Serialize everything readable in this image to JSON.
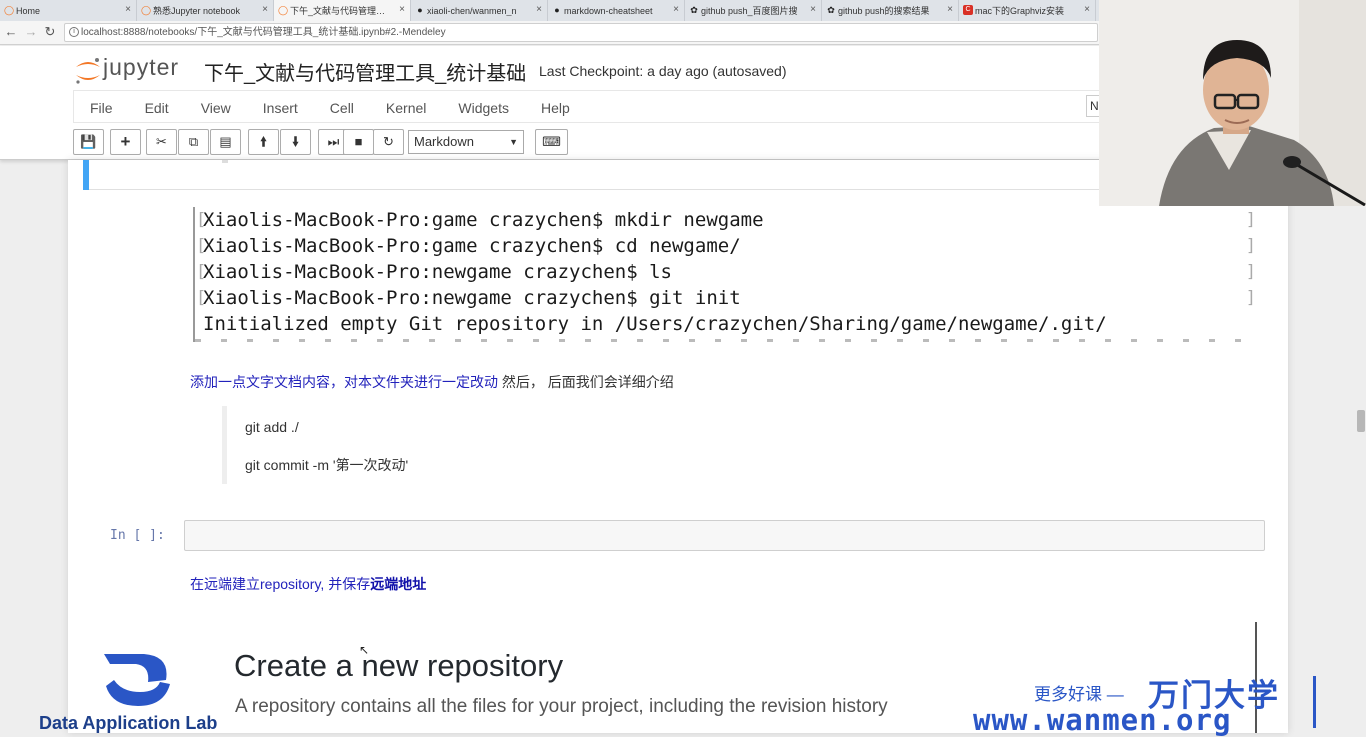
{
  "browser": {
    "tabs": [
      {
        "label": "Home",
        "icon": "jupyter-icon"
      },
      {
        "label": "熟悉Jupyter notebook",
        "icon": "jupyter-icon"
      },
      {
        "label": "下午_文献与代码管理工具",
        "icon": "jupyter-icon"
      },
      {
        "label": "xiaoli-chen/wanmen_n",
        "icon": "github-icon"
      },
      {
        "label": "markdown-cheatsheet",
        "icon": "github-icon"
      },
      {
        "label": "github push_百度图片搜",
        "icon": "baidu-icon"
      },
      {
        "label": "github push的搜索结果",
        "icon": "baidu-icon"
      },
      {
        "label": "mac下的Graphviz安装",
        "icon": "csdn-icon"
      }
    ],
    "active_tab_index": 2,
    "url": "localhost:8888/notebooks/下午_文献与代码管理工具_统计基础.ipynb#2.-Mendeley"
  },
  "jupyter": {
    "logo_text": "jupyter",
    "notebook_title": "下午_文献与代码管理工具_统计基础",
    "checkpoint": "Last Checkpoint: a day ago (autosaved)",
    "menu": [
      "File",
      "Edit",
      "View",
      "Insert",
      "Cell",
      "Kernel",
      "Widgets",
      "Help"
    ],
    "kernel_indicator": "N",
    "cell_type": "Markdown"
  },
  "terminal": {
    "lines": [
      "Xiaolis-MacBook-Pro:game crazychen$ mkdir newgame",
      "Xiaolis-MacBook-Pro:game crazychen$ cd newgame/",
      "Xiaolis-MacBook-Pro:newgame crazychen$ ls",
      "Xiaolis-MacBook-Pro:newgame crazychen$ git init",
      "Initialized empty Git repository in /Users/crazychen/Sharing/game/newgame/.git/"
    ]
  },
  "cells": {
    "md1_blue": "添加一点文字文档内容，对本文件夹进行一定改动",
    "md1_rest": " 然后， 后面我们会详细介绍",
    "quote_lines": [
      "git add ./",
      "git commit -m '第一次改动'"
    ],
    "code_prompt": "In [ ]:",
    "md2_text": "在远端建立repository, 并保存",
    "md2_bold": "远端地址",
    "gh_title": "Create a new repository",
    "gh_subtitle": "A repository contains all the files for your project, including the revision history"
  },
  "watermark": {
    "lab_name": "Data Application Lab",
    "more": "更多好课 —",
    "brand": "万门大学",
    "url": "www.wanmen.org"
  },
  "colors": {
    "jupyter_orange": "#f37726",
    "selected_cell": "#42a5f5",
    "link_blue": "#2222bb",
    "watermark_blue": "#2a56c6"
  }
}
